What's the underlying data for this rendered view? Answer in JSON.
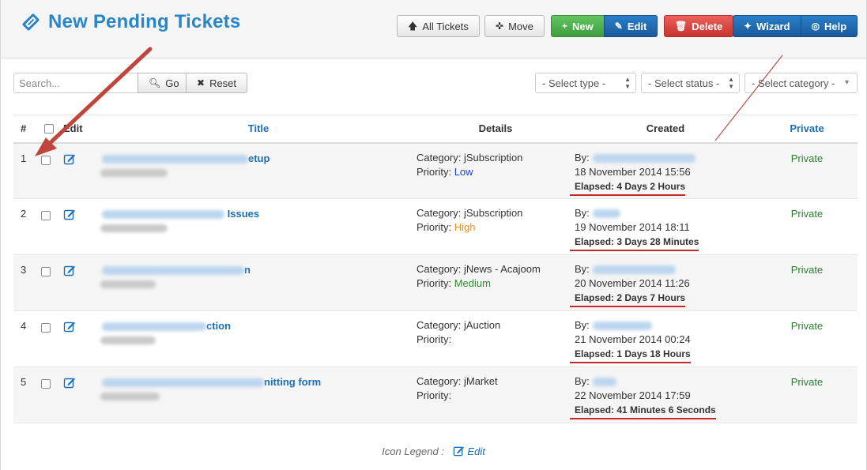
{
  "header": {
    "title": "New Pending Tickets",
    "buttons": {
      "all_tickets": "All Tickets",
      "move": "Move",
      "new": "New",
      "edit": "Edit",
      "delete": "Delete",
      "wizard": "Wizard",
      "help": "Help"
    }
  },
  "filters": {
    "search_placeholder": "Search...",
    "go": "Go",
    "reset": "Reset",
    "select_type": "- Select type -",
    "select_status": "- Select status -",
    "select_category": "- Select category -"
  },
  "table": {
    "columns": {
      "num": "#",
      "edit": "Edit",
      "title": "Title",
      "details": "Details",
      "created": "Created",
      "private": "Private"
    },
    "rows": [
      {
        "num": "1",
        "title_visible": "etup",
        "category": "Category: jSubscription",
        "priority_label": "Priority:",
        "priority": "Low",
        "priority_color": "#1f3fd1",
        "by": "By:",
        "date": "18 November 2014 15:56",
        "elapsed": "Elapsed: 4 Days 2 Hours",
        "private": "Private"
      },
      {
        "num": "2",
        "title_visible": "Issues",
        "category": "Category: jSubscription",
        "priority_label": "Priority:",
        "priority": "High",
        "priority_color": "#f0901e",
        "by": "By:",
        "date": "19 November 2014 18:11",
        "elapsed": "Elapsed: 3 Days 28 Minutes",
        "private": "Private"
      },
      {
        "num": "3",
        "title_visible": "n",
        "category": "Category: jNews - Acajoom",
        "priority_label": "Priority:",
        "priority": "Medium",
        "priority_color": "#2e8b2e",
        "by": "By:",
        "date": "20 November 2014 11:26",
        "elapsed": "Elapsed: 2 Days 7 Hours",
        "private": "Private"
      },
      {
        "num": "4",
        "title_visible": "ction",
        "category": "Category: jAuction",
        "priority_label": "Priority:",
        "priority": "",
        "priority_color": "#333333",
        "by": "By:",
        "date": "21 November 2014 00:24",
        "elapsed": "Elapsed: 1 Days 18 Hours",
        "private": "Private"
      },
      {
        "num": "5",
        "title_visible": "nitting form",
        "category": "Category: jMarket",
        "priority_label": "Priority:",
        "priority": "",
        "priority_color": "#333333",
        "by": "By:",
        "date": "22 November 2014 17:59",
        "elapsed": "Elapsed: 41 Minutes 6 Seconds",
        "private": "Private"
      }
    ]
  },
  "legend": {
    "label": "Icon Legend :",
    "edit": "Edit"
  },
  "colors": {
    "accent": "#2a86c6",
    "link": "#1b6fb5",
    "private": "#2e7d32",
    "annotation": "#c62828"
  }
}
